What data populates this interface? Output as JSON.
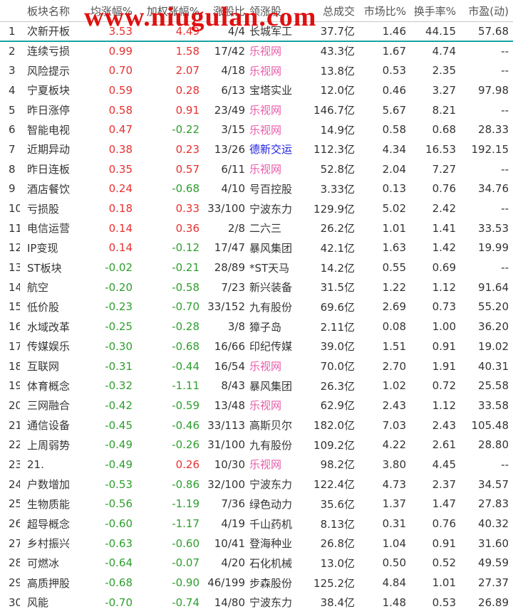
{
  "watermark": "www.niugulan.com",
  "table": {
    "headers": [
      "",
      "板块名称",
      "均涨幅%",
      "加权涨幅%",
      "涨股比",
      "领涨股",
      "总成交",
      "市场比%",
      "换手率%",
      "市盈(动)"
    ],
    "rows": [
      {
        "idx": "1",
        "name": "次新开板",
        "avg": "3.53",
        "wavg": "4.49",
        "ratio": "4/4",
        "leader": "长城军工",
        "vol": "37.7亿",
        "mkt": "1.46",
        "turn": "44.15",
        "pe": "57.68",
        "avg_dir": "up",
        "wavg_dir": "up",
        "leader_style": "name"
      },
      {
        "idx": "2",
        "name": "连续亏损",
        "avg": "0.99",
        "wavg": "1.58",
        "ratio": "17/42",
        "leader": "乐视网",
        "vol": "43.3亿",
        "mkt": "1.67",
        "turn": "4.74",
        "pe": "--",
        "avg_dir": "up",
        "wavg_dir": "up",
        "leader_style": "pink"
      },
      {
        "idx": "3",
        "name": "风险提示",
        "avg": "0.70",
        "wavg": "2.07",
        "ratio": "4/18",
        "leader": "乐视网",
        "vol": "13.8亿",
        "mkt": "0.53",
        "turn": "2.35",
        "pe": "--",
        "avg_dir": "up",
        "wavg_dir": "up",
        "leader_style": "pink"
      },
      {
        "idx": "4",
        "name": "宁夏板块",
        "avg": "0.59",
        "wavg": "0.28",
        "ratio": "6/13",
        "leader": "宝塔实业",
        "vol": "12.0亿",
        "mkt": "0.46",
        "turn": "3.27",
        "pe": "97.98",
        "avg_dir": "up",
        "wavg_dir": "up",
        "leader_style": "name"
      },
      {
        "idx": "5",
        "name": "昨日涨停",
        "avg": "0.58",
        "wavg": "0.91",
        "ratio": "23/49",
        "leader": "乐视网",
        "vol": "146.7亿",
        "mkt": "5.67",
        "turn": "8.21",
        "pe": "--",
        "avg_dir": "up",
        "wavg_dir": "up",
        "leader_style": "pink"
      },
      {
        "idx": "6",
        "name": "智能电视",
        "avg": "0.47",
        "wavg": "-0.22",
        "ratio": "3/15",
        "leader": "乐视网",
        "vol": "14.9亿",
        "mkt": "0.58",
        "turn": "0.68",
        "pe": "28.33",
        "avg_dir": "up",
        "wavg_dir": "down",
        "leader_style": "pink"
      },
      {
        "idx": "7",
        "name": "近期异动",
        "avg": "0.38",
        "wavg": "0.23",
        "ratio": "13/26",
        "leader": "德新交运",
        "vol": "112.3亿",
        "mkt": "4.34",
        "turn": "16.53",
        "pe": "192.15",
        "avg_dir": "up",
        "wavg_dir": "up",
        "leader_style": "blue"
      },
      {
        "idx": "8",
        "name": "昨日连板",
        "avg": "0.35",
        "wavg": "0.57",
        "ratio": "6/11",
        "leader": "乐视网",
        "vol": "52.8亿",
        "mkt": "2.04",
        "turn": "7.27",
        "pe": "--",
        "avg_dir": "up",
        "wavg_dir": "up",
        "leader_style": "pink"
      },
      {
        "idx": "9",
        "name": "酒店餐饮",
        "avg": "0.24",
        "wavg": "-0.68",
        "ratio": "4/10",
        "leader": "号百控股",
        "vol": "3.33亿",
        "mkt": "0.13",
        "turn": "0.76",
        "pe": "34.76",
        "avg_dir": "up",
        "wavg_dir": "down",
        "leader_style": "name"
      },
      {
        "idx": "10",
        "name": "亏损股",
        "avg": "0.18",
        "wavg": "0.33",
        "ratio": "33/100",
        "leader": "宁波东力",
        "vol": "129.9亿",
        "mkt": "5.02",
        "turn": "2.42",
        "pe": "--",
        "avg_dir": "up",
        "wavg_dir": "up",
        "leader_style": "name"
      },
      {
        "idx": "11",
        "name": "电信运营",
        "avg": "0.14",
        "wavg": "0.36",
        "ratio": "2/8",
        "leader": "二六三",
        "vol": "26.2亿",
        "mkt": "1.01",
        "turn": "1.41",
        "pe": "33.53",
        "avg_dir": "up",
        "wavg_dir": "up",
        "leader_style": "name"
      },
      {
        "idx": "12",
        "name": "IP变现",
        "avg": "0.14",
        "wavg": "-0.12",
        "ratio": "17/47",
        "leader": "暴风集团",
        "vol": "42.1亿",
        "mkt": "1.63",
        "turn": "1.42",
        "pe": "19.99",
        "avg_dir": "up",
        "wavg_dir": "down",
        "leader_style": "name"
      },
      {
        "idx": "13",
        "name": "ST板块",
        "avg": "-0.02",
        "wavg": "-0.21",
        "ratio": "28/89",
        "leader": "*ST天马",
        "vol": "14.2亿",
        "mkt": "0.55",
        "turn": "0.69",
        "pe": "--",
        "avg_dir": "down",
        "wavg_dir": "down",
        "leader_style": "name"
      },
      {
        "idx": "14",
        "name": "航空",
        "avg": "-0.20",
        "wavg": "-0.58",
        "ratio": "7/23",
        "leader": "新兴装备",
        "vol": "31.5亿",
        "mkt": "1.22",
        "turn": "1.12",
        "pe": "91.64",
        "avg_dir": "down",
        "wavg_dir": "down",
        "leader_style": "name"
      },
      {
        "idx": "15",
        "name": "低价股",
        "avg": "-0.23",
        "wavg": "-0.70",
        "ratio": "33/152",
        "leader": "九有股份",
        "vol": "69.6亿",
        "mkt": "2.69",
        "turn": "0.73",
        "pe": "55.20",
        "avg_dir": "down",
        "wavg_dir": "down",
        "leader_style": "name"
      },
      {
        "idx": "16",
        "name": "水域改革",
        "avg": "-0.25",
        "wavg": "-0.28",
        "ratio": "3/8",
        "leader": "獐子岛",
        "vol": "2.11亿",
        "mkt": "0.08",
        "turn": "1.00",
        "pe": "36.20",
        "avg_dir": "down",
        "wavg_dir": "down",
        "leader_style": "name"
      },
      {
        "idx": "17",
        "name": "传媒娱乐",
        "avg": "-0.30",
        "wavg": "-0.68",
        "ratio": "16/66",
        "leader": "印纪传媒",
        "vol": "39.0亿",
        "mkt": "1.51",
        "turn": "0.91",
        "pe": "19.02",
        "avg_dir": "down",
        "wavg_dir": "down",
        "leader_style": "name"
      },
      {
        "idx": "18",
        "name": "互联网",
        "avg": "-0.31",
        "wavg": "-0.44",
        "ratio": "16/54",
        "leader": "乐视网",
        "vol": "70.0亿",
        "mkt": "2.70",
        "turn": "1.91",
        "pe": "40.31",
        "avg_dir": "down",
        "wavg_dir": "down",
        "leader_style": "pink"
      },
      {
        "idx": "19",
        "name": "体育概念",
        "avg": "-0.32",
        "wavg": "-1.11",
        "ratio": "8/43",
        "leader": "暴风集团",
        "vol": "26.3亿",
        "mkt": "1.02",
        "turn": "0.72",
        "pe": "25.58",
        "avg_dir": "down",
        "wavg_dir": "down",
        "leader_style": "name"
      },
      {
        "idx": "20",
        "name": "三网融合",
        "avg": "-0.42",
        "wavg": "-0.59",
        "ratio": "13/48",
        "leader": "乐视网",
        "vol": "62.9亿",
        "mkt": "2.43",
        "turn": "1.12",
        "pe": "33.58",
        "avg_dir": "down",
        "wavg_dir": "down",
        "leader_style": "pink"
      },
      {
        "idx": "21",
        "name": "通信设备",
        "avg": "-0.45",
        "wavg": "-0.46",
        "ratio": "33/113",
        "leader": "高斯贝尔",
        "vol": "182.0亿",
        "mkt": "7.03",
        "turn": "2.43",
        "pe": "105.48",
        "avg_dir": "down",
        "wavg_dir": "down",
        "leader_style": "name"
      },
      {
        "idx": "22",
        "name": "上周弱势",
        "avg": "-0.49",
        "wavg": "-0.26",
        "ratio": "31/100",
        "leader": "九有股份",
        "vol": "109.2亿",
        "mkt": "4.22",
        "turn": "2.61",
        "pe": "28.80",
        "avg_dir": "down",
        "wavg_dir": "down",
        "leader_style": "name"
      },
      {
        "idx": "23",
        "name": "21.",
        "avg": "-0.49",
        "wavg": "0.26",
        "ratio": "10/30",
        "leader": "乐视网",
        "vol": "98.2亿",
        "mkt": "3.80",
        "turn": "4.45",
        "pe": "--",
        "avg_dir": "down",
        "wavg_dir": "up",
        "leader_style": "pink"
      },
      {
        "idx": "24",
        "name": "户数增加",
        "avg": "-0.53",
        "wavg": "-0.86",
        "ratio": "32/100",
        "leader": "宁波东力",
        "vol": "122.4亿",
        "mkt": "4.73",
        "turn": "2.37",
        "pe": "34.57",
        "avg_dir": "down",
        "wavg_dir": "down",
        "leader_style": "name"
      },
      {
        "idx": "25",
        "name": "生物质能",
        "avg": "-0.56",
        "wavg": "-1.19",
        "ratio": "7/36",
        "leader": "绿色动力",
        "vol": "35.6亿",
        "mkt": "1.37",
        "turn": "1.47",
        "pe": "27.83",
        "avg_dir": "down",
        "wavg_dir": "down",
        "leader_style": "name"
      },
      {
        "idx": "26",
        "name": "超导概念",
        "avg": "-0.60",
        "wavg": "-1.17",
        "ratio": "4/19",
        "leader": "千山药机",
        "vol": "8.13亿",
        "mkt": "0.31",
        "turn": "0.76",
        "pe": "40.32",
        "avg_dir": "down",
        "wavg_dir": "down",
        "leader_style": "name"
      },
      {
        "idx": "27",
        "name": "乡村振兴",
        "avg": "-0.63",
        "wavg": "-0.60",
        "ratio": "10/41",
        "leader": "登海种业",
        "vol": "26.8亿",
        "mkt": "1.04",
        "turn": "0.91",
        "pe": "31.60",
        "avg_dir": "down",
        "wavg_dir": "down",
        "leader_style": "name"
      },
      {
        "idx": "28",
        "name": "可燃冰",
        "avg": "-0.64",
        "wavg": "-0.07",
        "ratio": "4/20",
        "leader": "石化机械",
        "vol": "13.0亿",
        "mkt": "0.50",
        "turn": "0.52",
        "pe": "49.59",
        "avg_dir": "down",
        "wavg_dir": "down",
        "leader_style": "name"
      },
      {
        "idx": "29",
        "name": "高质押股",
        "avg": "-0.68",
        "wavg": "-0.90",
        "ratio": "46/199",
        "leader": "步森股份",
        "vol": "125.2亿",
        "mkt": "4.84",
        "turn": "1.01",
        "pe": "27.37",
        "avg_dir": "down",
        "wavg_dir": "down",
        "leader_style": "name"
      },
      {
        "idx": "30",
        "name": "风能",
        "avg": "-0.70",
        "wavg": "-0.74",
        "ratio": "14/80",
        "leader": "宁波东力",
        "vol": "38.4亿",
        "mkt": "1.48",
        "turn": "0.53",
        "pe": "26.89",
        "avg_dir": "down",
        "wavg_dir": "down",
        "leader_style": "name"
      }
    ]
  },
  "colors": {
    "up": "#e83030",
    "down": "#2e9e2e",
    "leader_pink": "#e85aa8",
    "leader_blue": "#2020e0",
    "selected_line": "#1aa3a3",
    "watermark": "#e01010"
  }
}
